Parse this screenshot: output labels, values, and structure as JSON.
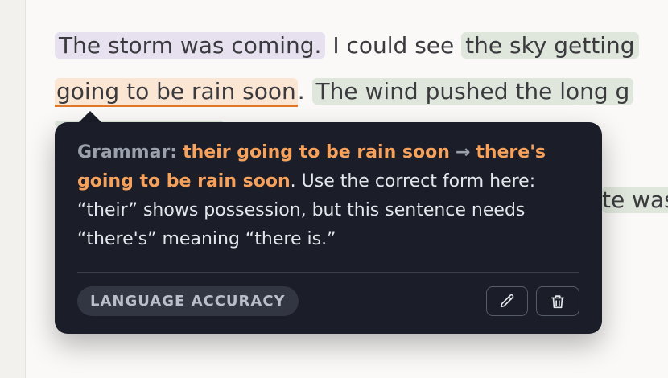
{
  "document": {
    "line1": {
      "sentence_highlight": "The storm was coming.",
      "plain": " I could see ",
      "green_segment": "the sky getting"
    },
    "line2": {
      "flagged_phrase": "going to be rain soon",
      "punct": ".",
      "green_segment": "The wind pushed the long g"
    },
    "line4_partial": "te was"
  },
  "tooltip": {
    "category_label": "Grammar:",
    "original_text": "their going to be rain soon",
    "arrow": "→",
    "suggestion_text": "there's going to be rain soon",
    "explanation": ". Use the correct form here: “their” shows possession, but this sentence needs “there's” meaning “there is.”",
    "badge": "LANGUAGE ACCURACY",
    "actions": [
      "pencil-icon",
      "trash-icon"
    ]
  },
  "colors": {
    "accent_orange": "#f6a25d",
    "underline_orange": "#e0782b",
    "tooltip_bg": "#1b1e28",
    "highlight_purple": "#e6e0ef",
    "highlight_green": "#dfe7dd"
  }
}
